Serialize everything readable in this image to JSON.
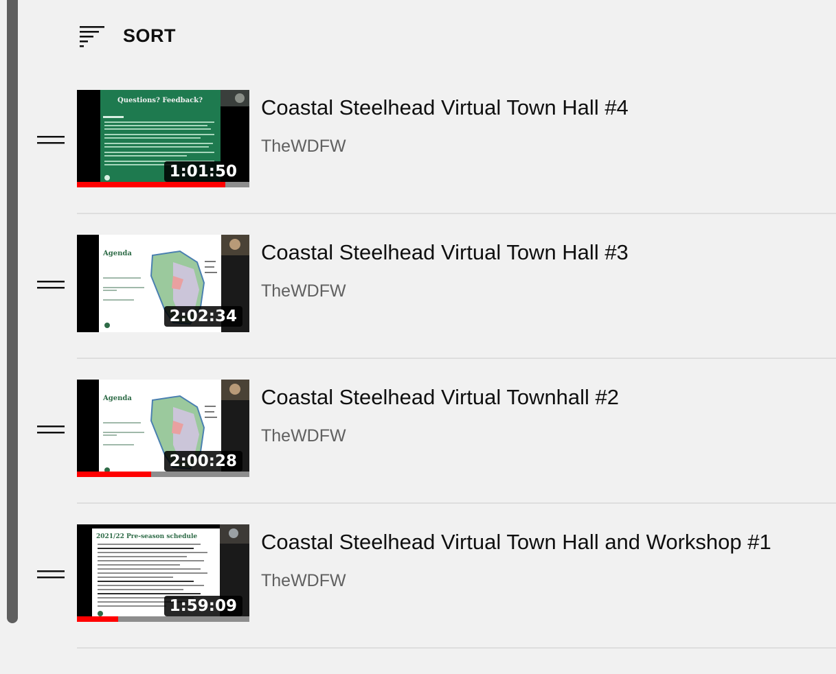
{
  "sort": {
    "label": "SORT",
    "icon": "sort-icon"
  },
  "items": [
    {
      "title": "Coastal Steelhead Virtual Town Hall #4",
      "channel": "TheWDFW",
      "duration": "1:01:50",
      "watched": 0.86,
      "thumbnail": {
        "heading": "Questions? Feedback?",
        "bg": "#1e7a4f"
      }
    },
    {
      "title": "Coastal Steelhead Virtual Town Hall #3",
      "channel": "TheWDFW",
      "duration": "2:02:34",
      "watched": 0,
      "thumbnail": {
        "heading": "Agenda",
        "bg": "#ffffff"
      }
    },
    {
      "title": "Coastal Steelhead Virtual Townhall #2",
      "channel": "TheWDFW",
      "duration": "2:00:28",
      "watched": 0.43,
      "thumbnail": {
        "heading": "Agenda",
        "bg": "#ffffff"
      }
    },
    {
      "title": "Coastal Steelhead Virtual Town Hall and Workshop #1",
      "channel": "TheWDFW",
      "duration": "1:59:09",
      "watched": 0.24,
      "thumbnail": {
        "heading": "2021/22 Pre-season schedule",
        "bg": "#ffffff"
      }
    }
  ],
  "colors": {
    "background": "#f1f1f1",
    "progress": "#ff0000",
    "scrollbar": "#5f5f5f",
    "title": "#0f0f0f",
    "channel": "#606060"
  }
}
